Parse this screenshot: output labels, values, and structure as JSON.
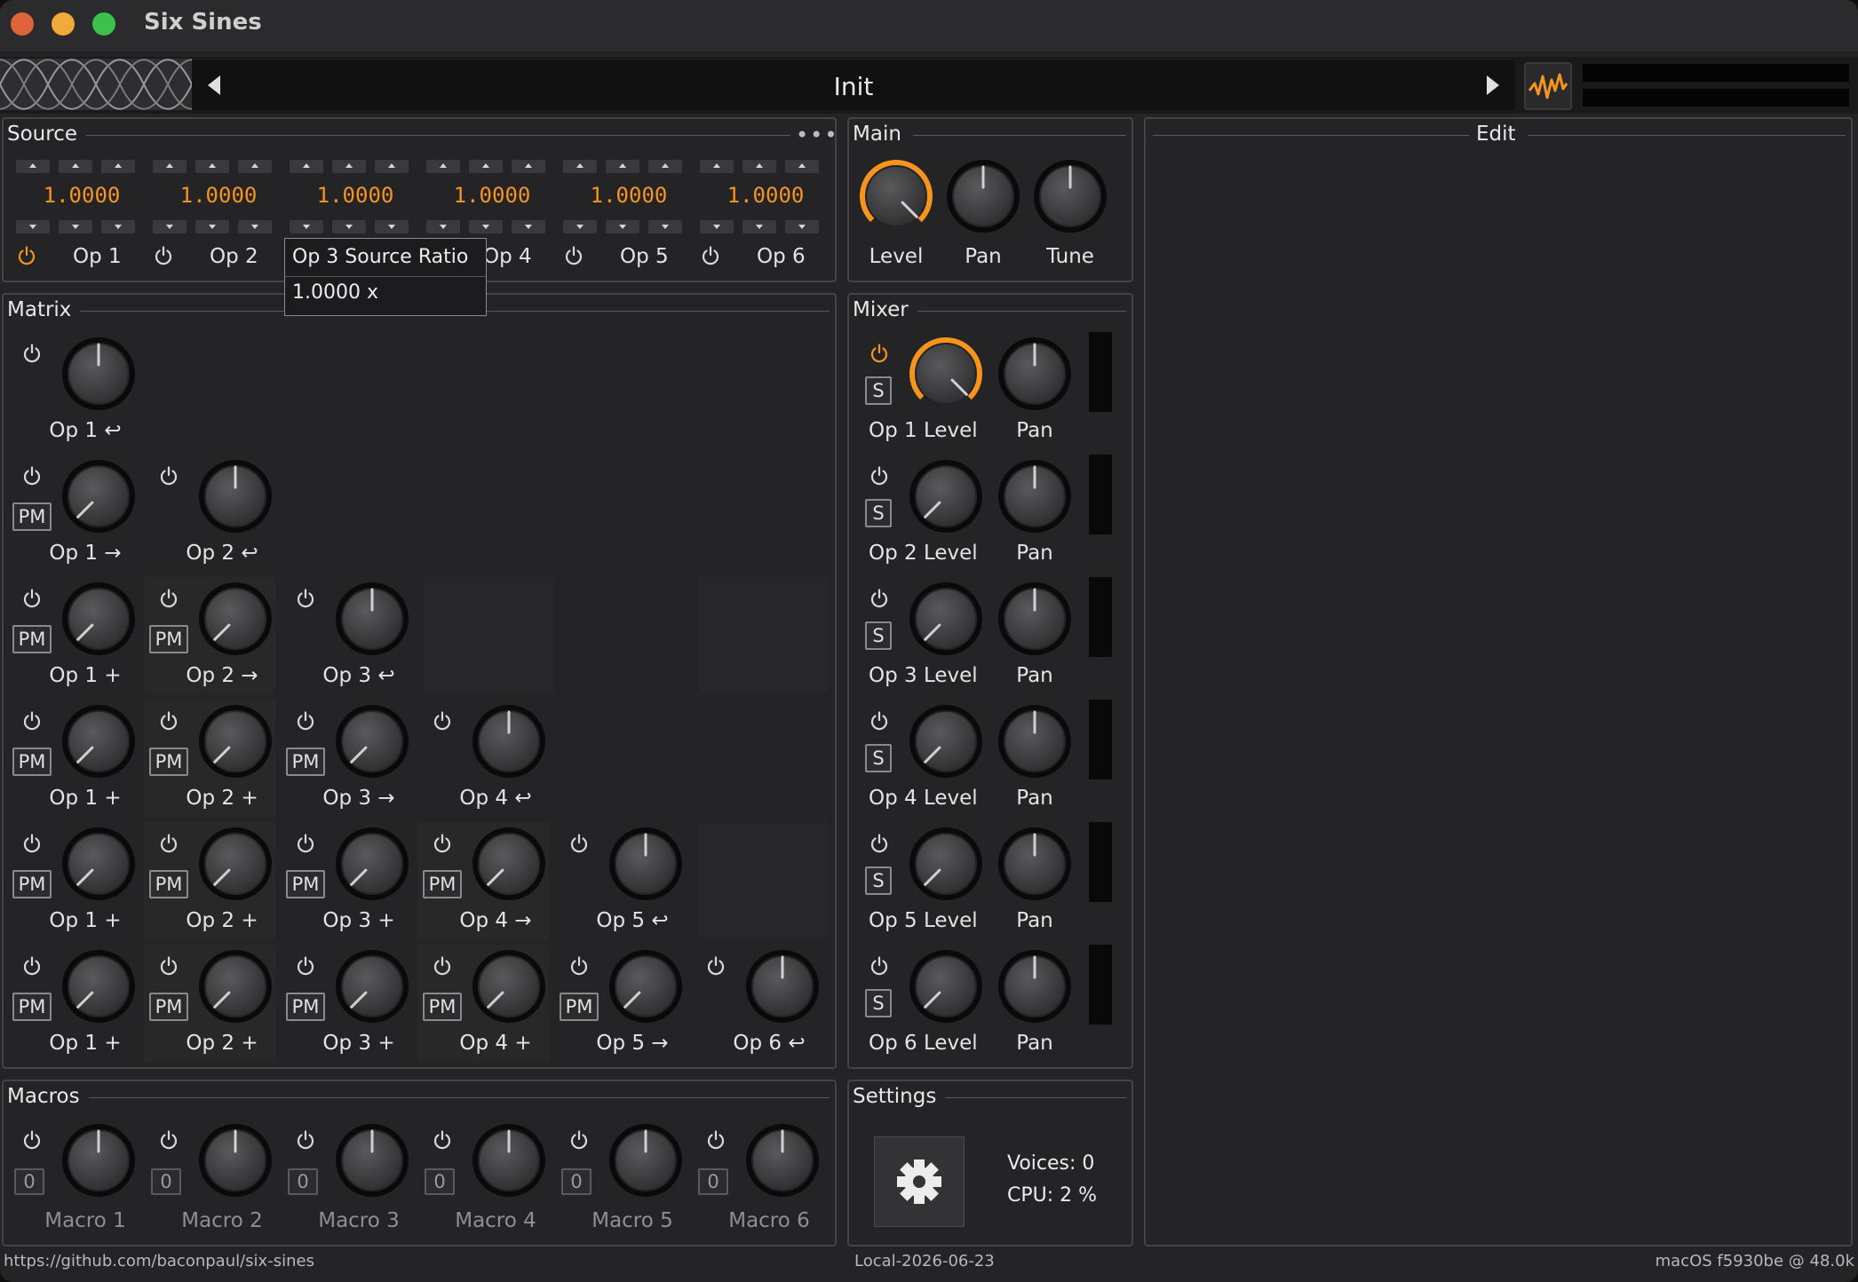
{
  "window": {
    "title": "Six Sines"
  },
  "preset": {
    "name": "Init"
  },
  "source": {
    "title": "Source",
    "ops": [
      {
        "ratio": "1.0000",
        "label": "Op 1",
        "active": true
      },
      {
        "ratio": "1.0000",
        "label": "Op 2",
        "active": false
      },
      {
        "ratio": "1.0000",
        "label": "Op 3",
        "active": false
      },
      {
        "ratio": "1.0000",
        "label": "Op 4",
        "active": false
      },
      {
        "ratio": "1.0000",
        "label": "Op 5",
        "active": false
      },
      {
        "ratio": "1.0000",
        "label": "Op 6",
        "active": false
      }
    ],
    "tooltip": {
      "title": "Op 3 Source Ratio",
      "value": "1.0000 x"
    }
  },
  "main": {
    "title": "Main",
    "knobs": [
      {
        "label": "Level",
        "value": 1.0
      },
      {
        "label": "Pan",
        "value": 0.5
      },
      {
        "label": "Tune",
        "value": 0.5
      }
    ]
  },
  "edit": {
    "title": "Edit"
  },
  "matrix": {
    "title": "Matrix",
    "rows": [
      [
        {
          "label": "Op 1 ↩",
          "pm": false,
          "value": 0.5
        }
      ],
      [
        {
          "label": "Op 1 →",
          "pm": true,
          "value": 0.0
        },
        {
          "label": "Op 2 ↩",
          "pm": false,
          "value": 0.5
        }
      ],
      [
        {
          "label": "Op 1 +",
          "pm": true,
          "value": 0.0
        },
        {
          "label": "Op 2 →",
          "pm": true,
          "value": 0.0
        },
        {
          "label": "Op 3 ↩",
          "pm": false,
          "value": 0.5
        }
      ],
      [
        {
          "label": "Op 1 +",
          "pm": true,
          "value": 0.0
        },
        {
          "label": "Op 2 +",
          "pm": true,
          "value": 0.0
        },
        {
          "label": "Op 3 →",
          "pm": true,
          "value": 0.0
        },
        {
          "label": "Op 4 ↩",
          "pm": false,
          "value": 0.5
        }
      ],
      [
        {
          "label": "Op 1 +",
          "pm": true,
          "value": 0.0
        },
        {
          "label": "Op 2 +",
          "pm": true,
          "value": 0.0
        },
        {
          "label": "Op 3 +",
          "pm": true,
          "value": 0.0
        },
        {
          "label": "Op 4 →",
          "pm": true,
          "value": 0.0
        },
        {
          "label": "Op 5 ↩",
          "pm": false,
          "value": 0.5
        }
      ],
      [
        {
          "label": "Op 1 +",
          "pm": true,
          "value": 0.0
        },
        {
          "label": "Op 2 +",
          "pm": true,
          "value": 0.0
        },
        {
          "label": "Op 3 +",
          "pm": true,
          "value": 0.0
        },
        {
          "label": "Op 4 +",
          "pm": true,
          "value": 0.0
        },
        {
          "label": "Op 5 →",
          "pm": true,
          "value": 0.0
        },
        {
          "label": "Op 6 ↩",
          "pm": false,
          "value": 0.5
        }
      ]
    ],
    "pm_label": "PM"
  },
  "mixer": {
    "title": "Mixer",
    "solo_label": "S",
    "pan_label": "Pan",
    "rows": [
      {
        "label": "Op 1 Level",
        "value": 1.0,
        "active": true
      },
      {
        "label": "Op 2 Level",
        "value": 0.0,
        "active": false
      },
      {
        "label": "Op 3 Level",
        "value": 0.0,
        "active": false
      },
      {
        "label": "Op 4 Level",
        "value": 0.0,
        "active": false
      },
      {
        "label": "Op 5 Level",
        "value": 0.0,
        "active": false
      },
      {
        "label": "Op 6 Level",
        "value": 0.0,
        "active": false
      }
    ]
  },
  "macros": {
    "title": "Macros",
    "items": [
      {
        "label": "Macro 1",
        "count": "0",
        "value": 0.5
      },
      {
        "label": "Macro 2",
        "count": "0",
        "value": 0.5
      },
      {
        "label": "Macro 3",
        "count": "0",
        "value": 0.5
      },
      {
        "label": "Macro 4",
        "count": "0",
        "value": 0.5
      },
      {
        "label": "Macro 5",
        "count": "0",
        "value": 0.5
      },
      {
        "label": "Macro 6",
        "count": "0",
        "value": 0.5
      }
    ]
  },
  "settings": {
    "title": "Settings",
    "voices": "Voices: 0",
    "cpu": "CPU: 2 %"
  },
  "footer": {
    "url": "https://github.com/baconpaul/six-sines",
    "build": "Local-2026-06-23",
    "platform": "macOS f5930be @ 48.0k"
  },
  "colors": {
    "accent": "#f7941d",
    "background": "#242426",
    "panel_border": "#444447"
  }
}
